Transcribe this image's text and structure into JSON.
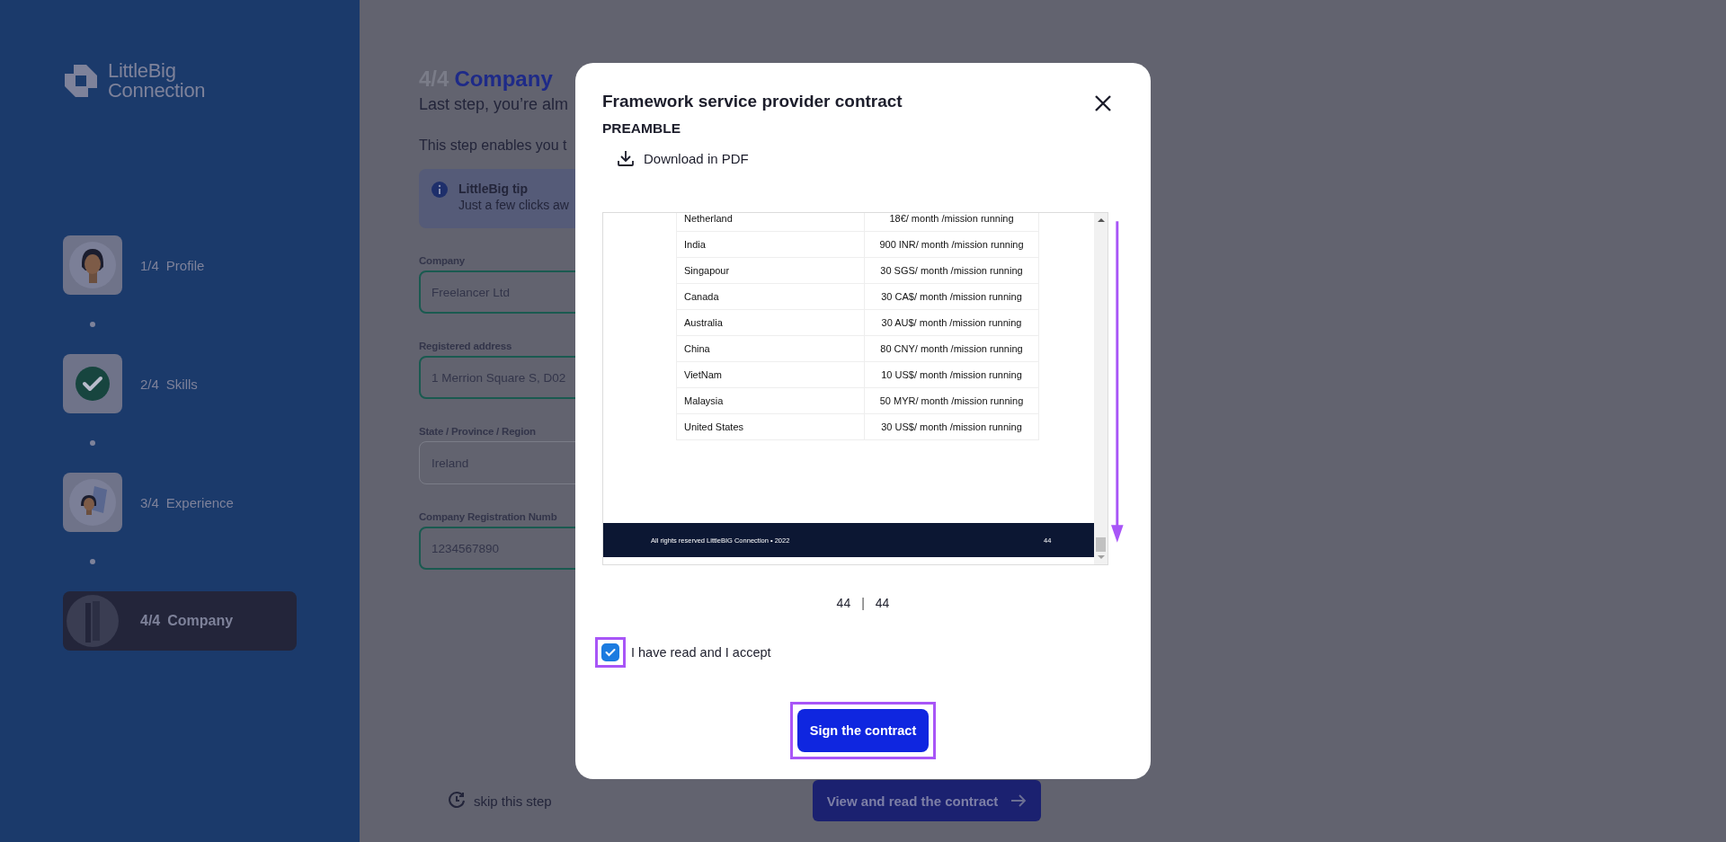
{
  "sidebar": {
    "logo": [
      "LittleBig",
      "Connection"
    ],
    "steps": [
      {
        "number": "1/4",
        "label": "Profile",
        "kind": "avatar",
        "selected": false
      },
      {
        "number": "2/4",
        "label": "Skills",
        "kind": "check",
        "selected": false
      },
      {
        "number": "3/4",
        "label": "Experience",
        "kind": "documents",
        "selected": false
      },
      {
        "number": "4/4",
        "label": "Company",
        "kind": "building",
        "selected": true
      }
    ]
  },
  "form": {
    "step": "4/4",
    "title": "Company",
    "subtitle": "Last step, you’re alm",
    "intro": "This step enables you t",
    "tip": {
      "title": "LittleBig tip",
      "text": "Just a few clicks aw"
    },
    "fields": [
      {
        "label": "Company",
        "value": "Freelancer Ltd",
        "valid": true
      },
      {
        "label": "Registered address",
        "value": "1 Merrion Square S, D02",
        "valid": true
      },
      {
        "label": "State / Province / Region",
        "value": "Ireland",
        "valid": false
      },
      {
        "label": "Company Registration Numb",
        "value": "1234567890",
        "valid": true
      }
    ]
  },
  "footer": {
    "skip": "skip this step",
    "next": "View and read the contract"
  },
  "modal": {
    "title": "Framework service provider contract",
    "section": "PREAMBLE",
    "download": "Download in PDF",
    "document": {
      "rows": [
        {
          "country": "Netherland",
          "price": "18€/ month /mission running"
        },
        {
          "country": "India",
          "price": "900 INR/ month /mission running"
        },
        {
          "country": "Singapour",
          "price": "30 SGS/ month /mission running"
        },
        {
          "country": "Canada",
          "price": "30 CA$/ month /mission running"
        },
        {
          "country": "Australia",
          "price": "30 AU$/ month /mission running"
        },
        {
          "country": "China",
          "price": "80 CNY/ month /mission running"
        },
        {
          "country": "VietNam",
          "price": "10 US$/ month /mission running"
        },
        {
          "country": "Malaysia",
          "price": "50 MYR/ month /mission running"
        },
        {
          "country": "United States",
          "price": "30 US$/ month /mission running"
        }
      ],
      "footer_text": "All rights reserved LittleBIG Connection • 2022",
      "page_number": "44"
    },
    "pager": {
      "current": "44",
      "separator": "|",
      "total": "44"
    },
    "accept": {
      "label": "I have read and I accept",
      "checked": true,
      "highlighted": true
    },
    "sign_button": {
      "label": "Sign the contract",
      "highlighted": true
    }
  }
}
